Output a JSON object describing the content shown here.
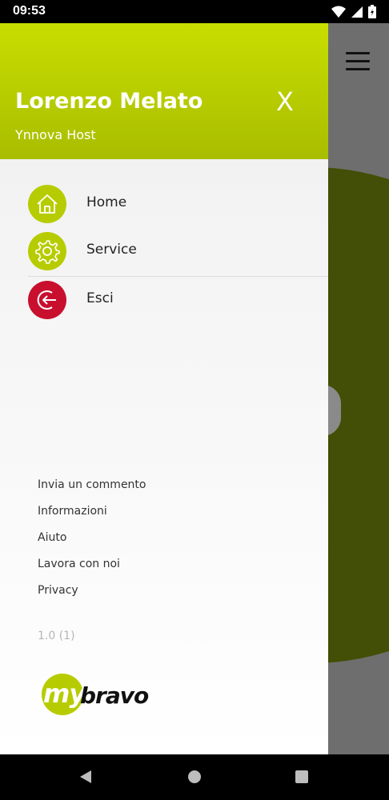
{
  "status_bar": {
    "time": "09:53",
    "icons": [
      "wifi-icon",
      "signal-icon",
      "battery-icon"
    ]
  },
  "drawer": {
    "header": {
      "user_name": "Lorenzo Melato",
      "user_role": "Ynnova Host",
      "close_label": "X"
    },
    "menu": [
      {
        "label": "Home",
        "icon": "home-icon",
        "color": "#b7cc00"
      },
      {
        "label": "Service",
        "icon": "gear-icon",
        "color": "#b7cc00"
      },
      {
        "label": "Esci",
        "icon": "logout-icon",
        "color": "#c8102e"
      }
    ],
    "links": [
      "Invia un commento",
      "Informazioni",
      "Aiuto",
      "Lavora con noi",
      "Privacy"
    ],
    "version": "1.0 (1)",
    "logo": {
      "part1": "my",
      "part2": "bravo"
    }
  },
  "app": {
    "menu_icon": "hamburger-icon"
  },
  "nav_bar": {
    "buttons": [
      "back-icon",
      "home-icon",
      "recents-icon"
    ]
  },
  "colors": {
    "accent": "#b7cc00",
    "danger": "#c8102e",
    "background_dim": "#6e6e6e"
  }
}
